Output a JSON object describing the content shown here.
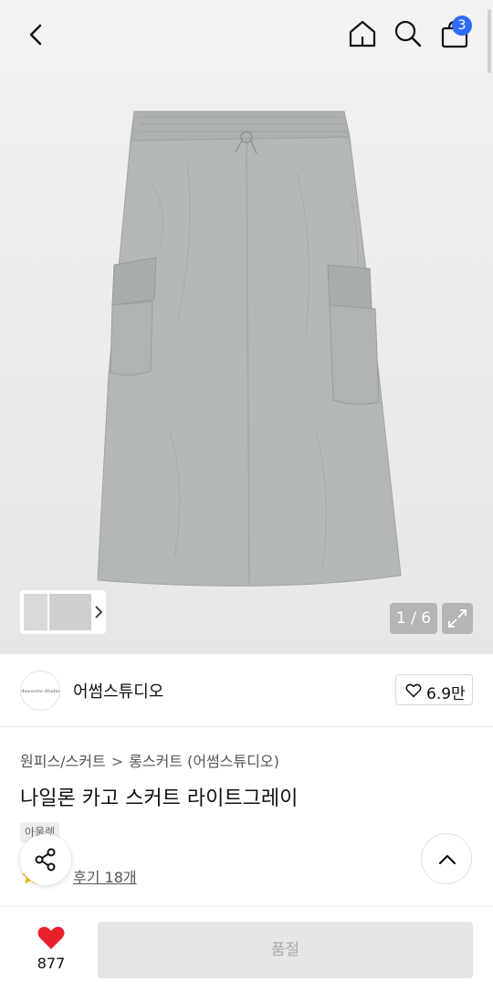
{
  "header": {
    "cart_count": "3",
    "icons": [
      "back-icon",
      "home-icon",
      "search-icon",
      "cart-icon"
    ]
  },
  "gallery": {
    "counter": "1 / 6",
    "expand_icon": "expand-icon",
    "product_color": "#b4b8b4"
  },
  "brand": {
    "logo_text": "Awesome Studio",
    "name": "어썸스튜디오",
    "like_count": "6.9만"
  },
  "product": {
    "breadcrumb": [
      "원피스/스커트",
      "롱스커트 (어썸스튜디오)"
    ],
    "breadcrumb_separator": ">",
    "title": "나일론 카고 스커트 라이트그레이",
    "tag": "아울렛",
    "review_link": "후기 18개"
  },
  "bottom": {
    "wish_count": "877",
    "buy_label": "품절"
  },
  "colors": {
    "badge": "#2f6cf6",
    "heart": "#e8202c",
    "star": "#f5b400"
  }
}
